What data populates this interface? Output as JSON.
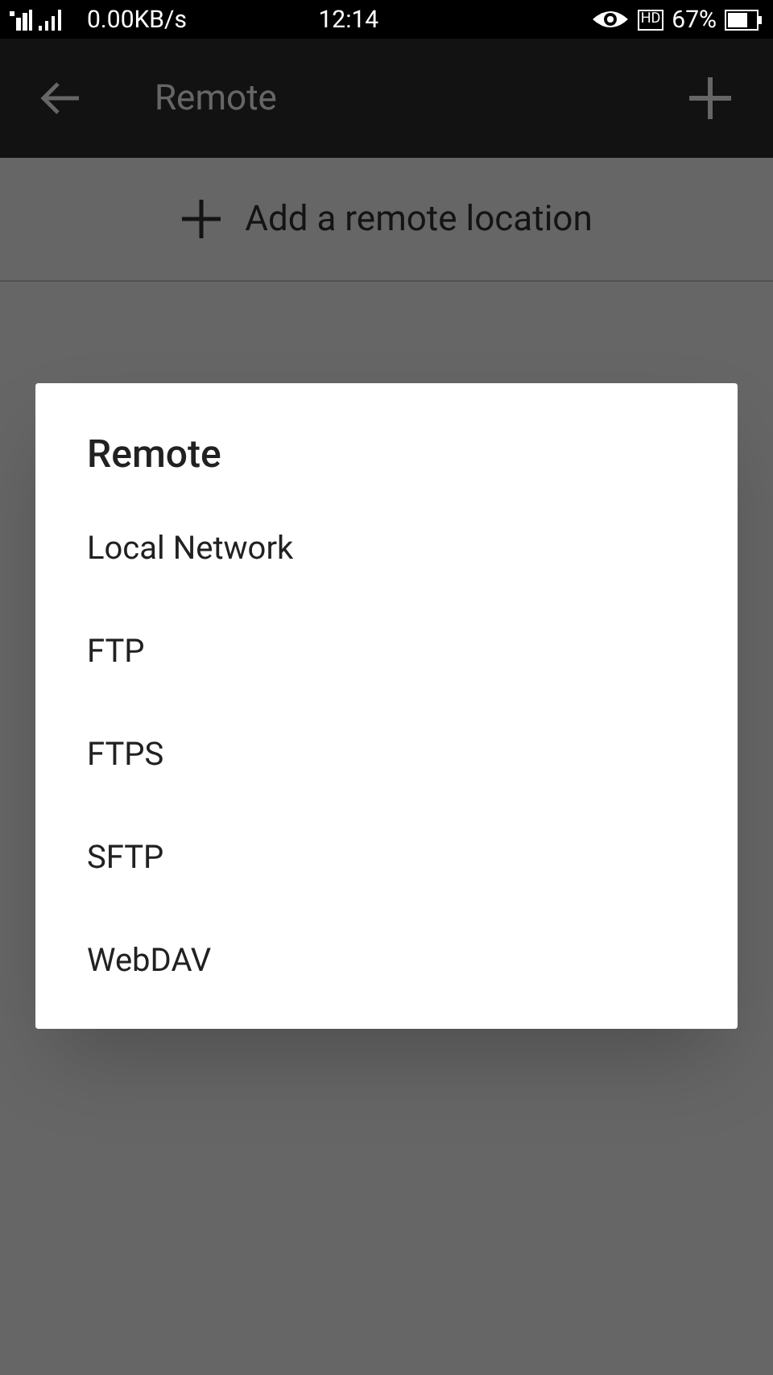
{
  "status_bar": {
    "speed": "0.00KB/s",
    "time": "12:14",
    "hd_badge": "HD",
    "battery": "67%"
  },
  "toolbar": {
    "title": "Remote"
  },
  "add_row": {
    "label": "Add a remote location"
  },
  "dialog": {
    "title": "Remote",
    "items": [
      {
        "label": "Local Network"
      },
      {
        "label": "FTP"
      },
      {
        "label": "FTPS"
      },
      {
        "label": "SFTP"
      },
      {
        "label": "WebDAV"
      }
    ]
  }
}
